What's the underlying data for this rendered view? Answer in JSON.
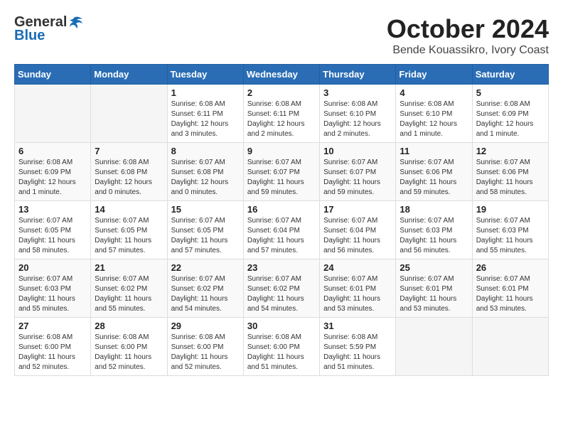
{
  "header": {
    "logo_general": "General",
    "logo_blue": "Blue",
    "month": "October 2024",
    "location": "Bende Kouassikro, Ivory Coast"
  },
  "days_of_week": [
    "Sunday",
    "Monday",
    "Tuesday",
    "Wednesday",
    "Thursday",
    "Friday",
    "Saturday"
  ],
  "weeks": [
    [
      {
        "day": "",
        "info": ""
      },
      {
        "day": "",
        "info": ""
      },
      {
        "day": "1",
        "info": "Sunrise: 6:08 AM\nSunset: 6:11 PM\nDaylight: 12 hours and 3 minutes."
      },
      {
        "day": "2",
        "info": "Sunrise: 6:08 AM\nSunset: 6:11 PM\nDaylight: 12 hours and 2 minutes."
      },
      {
        "day": "3",
        "info": "Sunrise: 6:08 AM\nSunset: 6:10 PM\nDaylight: 12 hours and 2 minutes."
      },
      {
        "day": "4",
        "info": "Sunrise: 6:08 AM\nSunset: 6:10 PM\nDaylight: 12 hours and 1 minute."
      },
      {
        "day": "5",
        "info": "Sunrise: 6:08 AM\nSunset: 6:09 PM\nDaylight: 12 hours and 1 minute."
      }
    ],
    [
      {
        "day": "6",
        "info": "Sunrise: 6:08 AM\nSunset: 6:09 PM\nDaylight: 12 hours and 1 minute."
      },
      {
        "day": "7",
        "info": "Sunrise: 6:08 AM\nSunset: 6:08 PM\nDaylight: 12 hours and 0 minutes."
      },
      {
        "day": "8",
        "info": "Sunrise: 6:07 AM\nSunset: 6:08 PM\nDaylight: 12 hours and 0 minutes."
      },
      {
        "day": "9",
        "info": "Sunrise: 6:07 AM\nSunset: 6:07 PM\nDaylight: 11 hours and 59 minutes."
      },
      {
        "day": "10",
        "info": "Sunrise: 6:07 AM\nSunset: 6:07 PM\nDaylight: 11 hours and 59 minutes."
      },
      {
        "day": "11",
        "info": "Sunrise: 6:07 AM\nSunset: 6:06 PM\nDaylight: 11 hours and 59 minutes."
      },
      {
        "day": "12",
        "info": "Sunrise: 6:07 AM\nSunset: 6:06 PM\nDaylight: 11 hours and 58 minutes."
      }
    ],
    [
      {
        "day": "13",
        "info": "Sunrise: 6:07 AM\nSunset: 6:05 PM\nDaylight: 11 hours and 58 minutes."
      },
      {
        "day": "14",
        "info": "Sunrise: 6:07 AM\nSunset: 6:05 PM\nDaylight: 11 hours and 57 minutes."
      },
      {
        "day": "15",
        "info": "Sunrise: 6:07 AM\nSunset: 6:05 PM\nDaylight: 11 hours and 57 minutes."
      },
      {
        "day": "16",
        "info": "Sunrise: 6:07 AM\nSunset: 6:04 PM\nDaylight: 11 hours and 57 minutes."
      },
      {
        "day": "17",
        "info": "Sunrise: 6:07 AM\nSunset: 6:04 PM\nDaylight: 11 hours and 56 minutes."
      },
      {
        "day": "18",
        "info": "Sunrise: 6:07 AM\nSunset: 6:03 PM\nDaylight: 11 hours and 56 minutes."
      },
      {
        "day": "19",
        "info": "Sunrise: 6:07 AM\nSunset: 6:03 PM\nDaylight: 11 hours and 55 minutes."
      }
    ],
    [
      {
        "day": "20",
        "info": "Sunrise: 6:07 AM\nSunset: 6:03 PM\nDaylight: 11 hours and 55 minutes."
      },
      {
        "day": "21",
        "info": "Sunrise: 6:07 AM\nSunset: 6:02 PM\nDaylight: 11 hours and 55 minutes."
      },
      {
        "day": "22",
        "info": "Sunrise: 6:07 AM\nSunset: 6:02 PM\nDaylight: 11 hours and 54 minutes."
      },
      {
        "day": "23",
        "info": "Sunrise: 6:07 AM\nSunset: 6:02 PM\nDaylight: 11 hours and 54 minutes."
      },
      {
        "day": "24",
        "info": "Sunrise: 6:07 AM\nSunset: 6:01 PM\nDaylight: 11 hours and 53 minutes."
      },
      {
        "day": "25",
        "info": "Sunrise: 6:07 AM\nSunset: 6:01 PM\nDaylight: 11 hours and 53 minutes."
      },
      {
        "day": "26",
        "info": "Sunrise: 6:07 AM\nSunset: 6:01 PM\nDaylight: 11 hours and 53 minutes."
      }
    ],
    [
      {
        "day": "27",
        "info": "Sunrise: 6:08 AM\nSunset: 6:00 PM\nDaylight: 11 hours and 52 minutes."
      },
      {
        "day": "28",
        "info": "Sunrise: 6:08 AM\nSunset: 6:00 PM\nDaylight: 11 hours and 52 minutes."
      },
      {
        "day": "29",
        "info": "Sunrise: 6:08 AM\nSunset: 6:00 PM\nDaylight: 11 hours and 52 minutes."
      },
      {
        "day": "30",
        "info": "Sunrise: 6:08 AM\nSunset: 6:00 PM\nDaylight: 11 hours and 51 minutes."
      },
      {
        "day": "31",
        "info": "Sunrise: 6:08 AM\nSunset: 5:59 PM\nDaylight: 11 hours and 51 minutes."
      },
      {
        "day": "",
        "info": ""
      },
      {
        "day": "",
        "info": ""
      }
    ]
  ]
}
